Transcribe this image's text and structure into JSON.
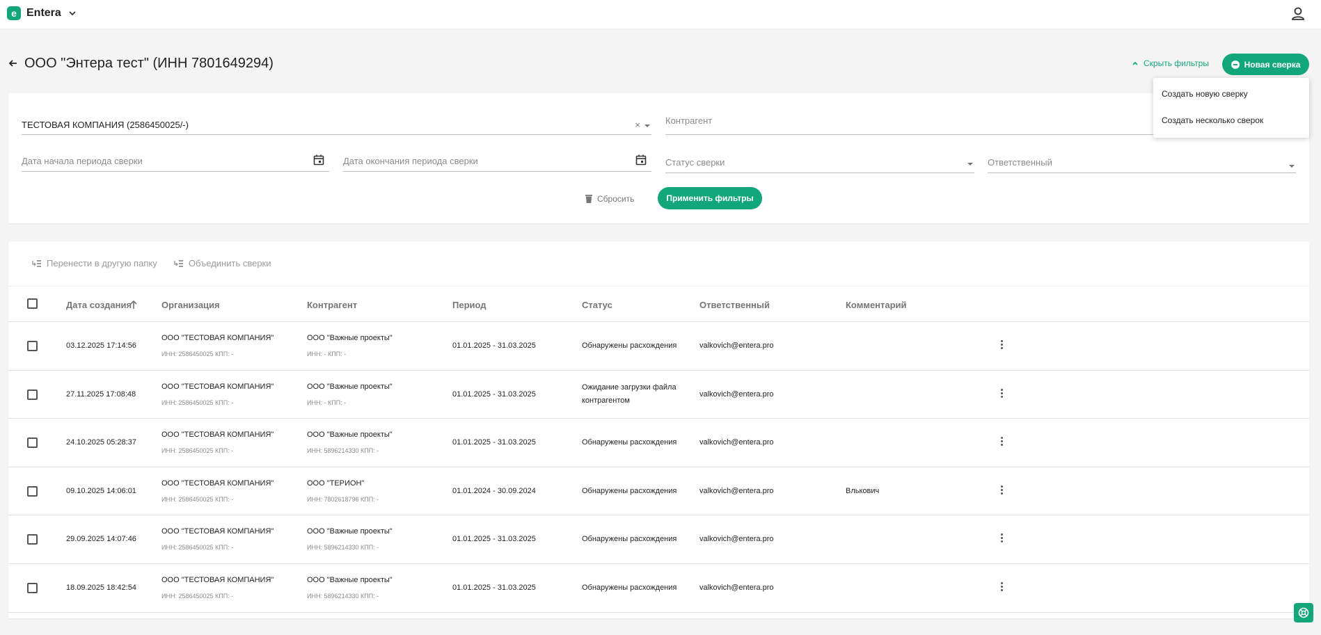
{
  "app": {
    "logo_letter": "e",
    "name": "Entera"
  },
  "header": {
    "title": "ООО \"Энтера тест\" (ИНН 7801649294)",
    "hide_filters": "Скрыть фильтры",
    "new_button": "Новая сверка"
  },
  "menu": {
    "items": [
      "Создать новую сверку",
      "Создать несколько сверок"
    ]
  },
  "filters": {
    "organization_value": "ТЕСТОВАЯ КОМПАНИЯ (2586450025/-)",
    "clear": "×",
    "counterparty_placeholder": "Контрагент",
    "period_start_placeholder": "Дата начала периода сверки",
    "period_end_placeholder": "Дата окончания периода сверки",
    "status_placeholder": "Статус сверки",
    "responsible_placeholder": "Ответственный",
    "reset": "Сбросить",
    "apply": "Применить фильтры"
  },
  "actions": {
    "move": "Перенести в другую папку",
    "merge": "Объединить сверки"
  },
  "table": {
    "columns": [
      "Дата создания",
      "Организация",
      "Контрагент",
      "Период",
      "Статус",
      "Ответственный",
      "Комментарий"
    ],
    "rows": [
      {
        "date": "03.12.2025 17:14:56",
        "org": "ООО \"ТЕСТОВАЯ КОМПАНИЯ\"",
        "org_sub": "ИНН: 2586450025 КПП: -",
        "cp": "ООО \"Важные проекты\"",
        "cp_sub": "ИНН: - КПП: -",
        "period": "01.01.2025 - 31.03.2025",
        "status": "Обнаружены расхождения",
        "status2": "",
        "resp": "valkovich@entera.pro",
        "comment": ""
      },
      {
        "date": "27.11.2025 17:08:48",
        "org": "ООО \"ТЕСТОВАЯ КОМПАНИЯ\"",
        "org_sub": "ИНН: 2586450025 КПП: -",
        "cp": "ООО \"Важные проекты\"",
        "cp_sub": "ИНН: - КПП: -",
        "period": "01.01.2025 - 31.03.2025",
        "status": "Ожидание загрузки файла",
        "status2": "контрагентом",
        "resp": "valkovich@entera.pro",
        "comment": ""
      },
      {
        "date": "24.10.2025 05:28:37",
        "org": "ООО \"ТЕСТОВАЯ КОМПАНИЯ\"",
        "org_sub": "ИНН: 2586450025 КПП: -",
        "cp": "ООО \"Важные проекты\"",
        "cp_sub": "ИНН: 5896214330 КПП: -",
        "period": "01.01.2025 - 31.03.2025",
        "status": "Обнаружены расхождения",
        "status2": "",
        "resp": "valkovich@entera.pro",
        "comment": ""
      },
      {
        "date": "09.10.2025 14:06:01",
        "org": "ООО \"ТЕСТОВАЯ КОМПАНИЯ\"",
        "org_sub": "ИНН: 2586450025 КПП: -",
        "cp": "ООО \"ТЕРИОН\"",
        "cp_sub": "ИНН: 7802618796 КПП: -",
        "period": "01.01.2024 - 30.09.2024",
        "status": "Обнаружены расхождения",
        "status2": "",
        "resp": "valkovich@entera.pro",
        "comment": "Влькович"
      },
      {
        "date": "29.09.2025 14:07:46",
        "org": "ООО \"ТЕСТОВАЯ КОМПАНИЯ\"",
        "org_sub": "ИНН: 2586450025 КПП: -",
        "cp": "ООО \"Важные проекты\"",
        "cp_sub": "ИНН: 5896214330 КПП: -",
        "period": "01.01.2025 - 31.03.2025",
        "status": "Обнаружены расхождения",
        "status2": "",
        "resp": "valkovich@entera.pro",
        "comment": ""
      },
      {
        "date": "18.09.2025 18:42:54",
        "org": "ООО \"ТЕСТОВАЯ КОМПАНИЯ\"",
        "org_sub": "ИНН: 2586450025 КПП: -",
        "cp": "ООО \"Важные проекты\"",
        "cp_sub": "ИНН: 5896214330 КПП: -",
        "period": "01.01.2025 - 31.03.2025",
        "status": "Обнаружены расхождения",
        "status2": "",
        "resp": "valkovich@entera.pro",
        "comment": ""
      }
    ]
  },
  "icons": [
    "chevron-down-icon",
    "user-icon",
    "back-arrow-icon",
    "chevron-up-icon",
    "minus-circle-icon",
    "calendar-icon",
    "trash-icon",
    "move-folder-icon",
    "merge-icon",
    "sort-up-icon",
    "kebab-menu-icon",
    "help-icon"
  ],
  "colors": {
    "accent": "#12a77a",
    "background": "#f4f4f4",
    "muted_text": "#8a8a8a"
  }
}
